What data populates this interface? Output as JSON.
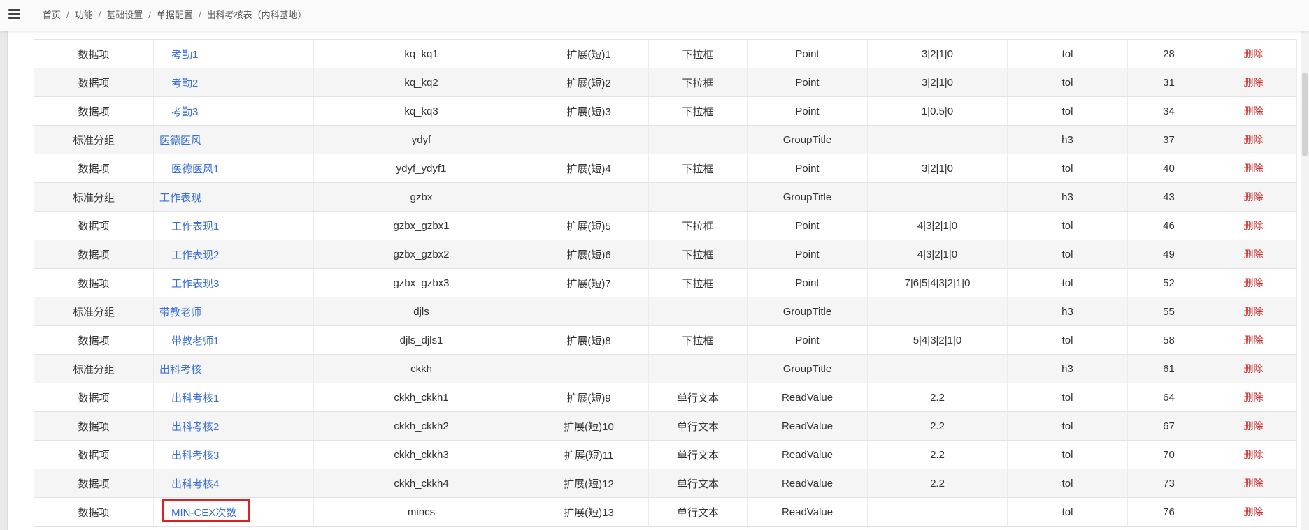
{
  "breadcrumb": {
    "items": [
      "首页",
      "功能",
      "基础设置",
      "单据配置",
      "出科考核表（内科基地）"
    ],
    "separator": "/"
  },
  "colors": {
    "link": "#3b6fd6",
    "delete": "#d03030",
    "highlight": "#e02020"
  },
  "table": {
    "delete_label": "删除",
    "rows": [
      {
        "type": "数据项",
        "name": "考勤1",
        "code": "kq_kq1",
        "ext": "扩展(短)1",
        "ctrl": "下拉框",
        "kind": "Point",
        "options": "3|2|1|0",
        "fmt": "tol",
        "order": "28",
        "indent": true
      },
      {
        "type": "数据项",
        "name": "考勤2",
        "code": "kq_kq2",
        "ext": "扩展(短)2",
        "ctrl": "下拉框",
        "kind": "Point",
        "options": "3|2|1|0",
        "fmt": "tol",
        "order": "31",
        "indent": true
      },
      {
        "type": "数据项",
        "name": "考勤3",
        "code": "kq_kq3",
        "ext": "扩展(短)3",
        "ctrl": "下拉框",
        "kind": "Point",
        "options": "1|0.5|0",
        "fmt": "tol",
        "order": "34",
        "indent": true
      },
      {
        "type": "标准分组",
        "name": "医德医风",
        "code": "ydyf",
        "ext": "",
        "ctrl": "",
        "kind": "GroupTitle",
        "options": "",
        "fmt": "h3",
        "order": "37",
        "indent": false
      },
      {
        "type": "数据项",
        "name": "医德医风1",
        "code": "ydyf_ydyf1",
        "ext": "扩展(短)4",
        "ctrl": "下拉框",
        "kind": "Point",
        "options": "3|2|1|0",
        "fmt": "tol",
        "order": "40",
        "indent": true
      },
      {
        "type": "标准分组",
        "name": "工作表现",
        "code": "gzbx",
        "ext": "",
        "ctrl": "",
        "kind": "GroupTitle",
        "options": "",
        "fmt": "h3",
        "order": "43",
        "indent": false
      },
      {
        "type": "数据项",
        "name": "工作表现1",
        "code": "gzbx_gzbx1",
        "ext": "扩展(短)5",
        "ctrl": "下拉框",
        "kind": "Point",
        "options": "4|3|2|1|0",
        "fmt": "tol",
        "order": "46",
        "indent": true
      },
      {
        "type": "数据项",
        "name": "工作表现2",
        "code": "gzbx_gzbx2",
        "ext": "扩展(短)6",
        "ctrl": "下拉框",
        "kind": "Point",
        "options": "4|3|2|1|0",
        "fmt": "tol",
        "order": "49",
        "indent": true
      },
      {
        "type": "数据项",
        "name": "工作表现3",
        "code": "gzbx_gzbx3",
        "ext": "扩展(短)7",
        "ctrl": "下拉框",
        "kind": "Point",
        "options": "7|6|5|4|3|2|1|0",
        "fmt": "tol",
        "order": "52",
        "indent": true
      },
      {
        "type": "标准分组",
        "name": "带教老师",
        "code": "djls",
        "ext": "",
        "ctrl": "",
        "kind": "GroupTitle",
        "options": "",
        "fmt": "h3",
        "order": "55",
        "indent": false
      },
      {
        "type": "数据项",
        "name": "带教老师1",
        "code": "djls_djls1",
        "ext": "扩展(短)8",
        "ctrl": "下拉框",
        "kind": "Point",
        "options": "5|4|3|2|1|0",
        "fmt": "tol",
        "order": "58",
        "indent": true
      },
      {
        "type": "标准分组",
        "name": "出科考核",
        "code": "ckkh",
        "ext": "",
        "ctrl": "",
        "kind": "GroupTitle",
        "options": "",
        "fmt": "h3",
        "order": "61",
        "indent": false
      },
      {
        "type": "数据项",
        "name": "出科考核1",
        "code": "ckkh_ckkh1",
        "ext": "扩展(短)9",
        "ctrl": "单行文本",
        "kind": "ReadValue",
        "options": "2.2",
        "fmt": "tol",
        "order": "64",
        "indent": true
      },
      {
        "type": "数据项",
        "name": "出科考核2",
        "code": "ckkh_ckkh2",
        "ext": "扩展(短)10",
        "ctrl": "单行文本",
        "kind": "ReadValue",
        "options": "2.2",
        "fmt": "tol",
        "order": "67",
        "indent": true
      },
      {
        "type": "数据项",
        "name": "出科考核3",
        "code": "ckkh_ckkh3",
        "ext": "扩展(短)11",
        "ctrl": "单行文本",
        "kind": "ReadValue",
        "options": "2.2",
        "fmt": "tol",
        "order": "70",
        "indent": true
      },
      {
        "type": "数据项",
        "name": "出科考核4",
        "code": "ckkh_ckkh4",
        "ext": "扩展(短)12",
        "ctrl": "单行文本",
        "kind": "ReadValue",
        "options": "2.2",
        "fmt": "tol",
        "order": "73",
        "indent": true
      },
      {
        "type": "数据项",
        "name": "MIN-CEX次数",
        "code": "mincs",
        "ext": "扩展(短)13",
        "ctrl": "单行文本",
        "kind": "ReadValue",
        "options": "",
        "fmt": "tol",
        "order": "76",
        "indent": true
      }
    ]
  }
}
